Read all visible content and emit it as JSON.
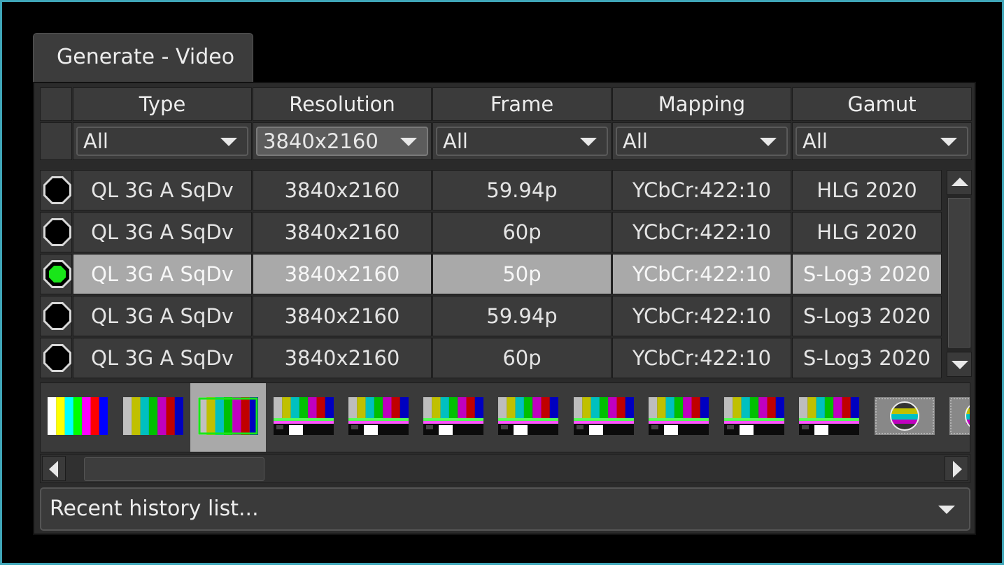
{
  "tab": {
    "label": "Generate - Video"
  },
  "columns": [
    "Type",
    "Resolution",
    "Frame",
    "Mapping",
    "Gamut"
  ],
  "filters": [
    "All",
    "3840x2160",
    "All",
    "All",
    "All"
  ],
  "rows": [
    {
      "type": "QL 3G A SqDv",
      "resolution": "3840x2160",
      "frame": "59.94p",
      "mapping": "YCbCr:422:10",
      "gamut": "HLG 2020",
      "selected": false
    },
    {
      "type": "QL 3G A SqDv",
      "resolution": "3840x2160",
      "frame": "60p",
      "mapping": "YCbCr:422:10",
      "gamut": "HLG 2020",
      "selected": false
    },
    {
      "type": "QL 3G A SqDv",
      "resolution": "3840x2160",
      "frame": "50p",
      "mapping": "YCbCr:422:10",
      "gamut": "S-Log3 2020",
      "selected": true
    },
    {
      "type": "QL 3G A SqDv",
      "resolution": "3840x2160",
      "frame": "59.94p",
      "mapping": "YCbCr:422:10",
      "gamut": "S-Log3 2020",
      "selected": false
    },
    {
      "type": "QL 3G A SqDv",
      "resolution": "3840x2160",
      "frame": "60p",
      "mapping": "YCbCr:422:10",
      "gamut": "S-Log3 2020",
      "selected": false
    }
  ],
  "pattern_thumbnails": [
    {
      "icon": "full-bars-icon"
    },
    {
      "icon": "smpte-bars-icon"
    },
    {
      "icon": "bars-outlined-icon",
      "selected": true
    },
    {
      "icon": "pluge-bars-icon"
    },
    {
      "icon": "pluge-bars-icon"
    },
    {
      "icon": "pluge-bars-icon"
    },
    {
      "icon": "pluge-bars-icon"
    },
    {
      "icon": "pluge-bars-icon"
    },
    {
      "icon": "pluge-bars-icon"
    },
    {
      "icon": "pluge-bars-icon"
    },
    {
      "icon": "pluge-bars-icon"
    },
    {
      "icon": "test-card-icon"
    },
    {
      "icon": "test-card-icon"
    }
  ],
  "history": {
    "label": "Recent history list..."
  },
  "colors": {
    "accent_border": "#3fa6b8",
    "selected_row": "#a9a9a9",
    "radio_on": "#19e619"
  }
}
